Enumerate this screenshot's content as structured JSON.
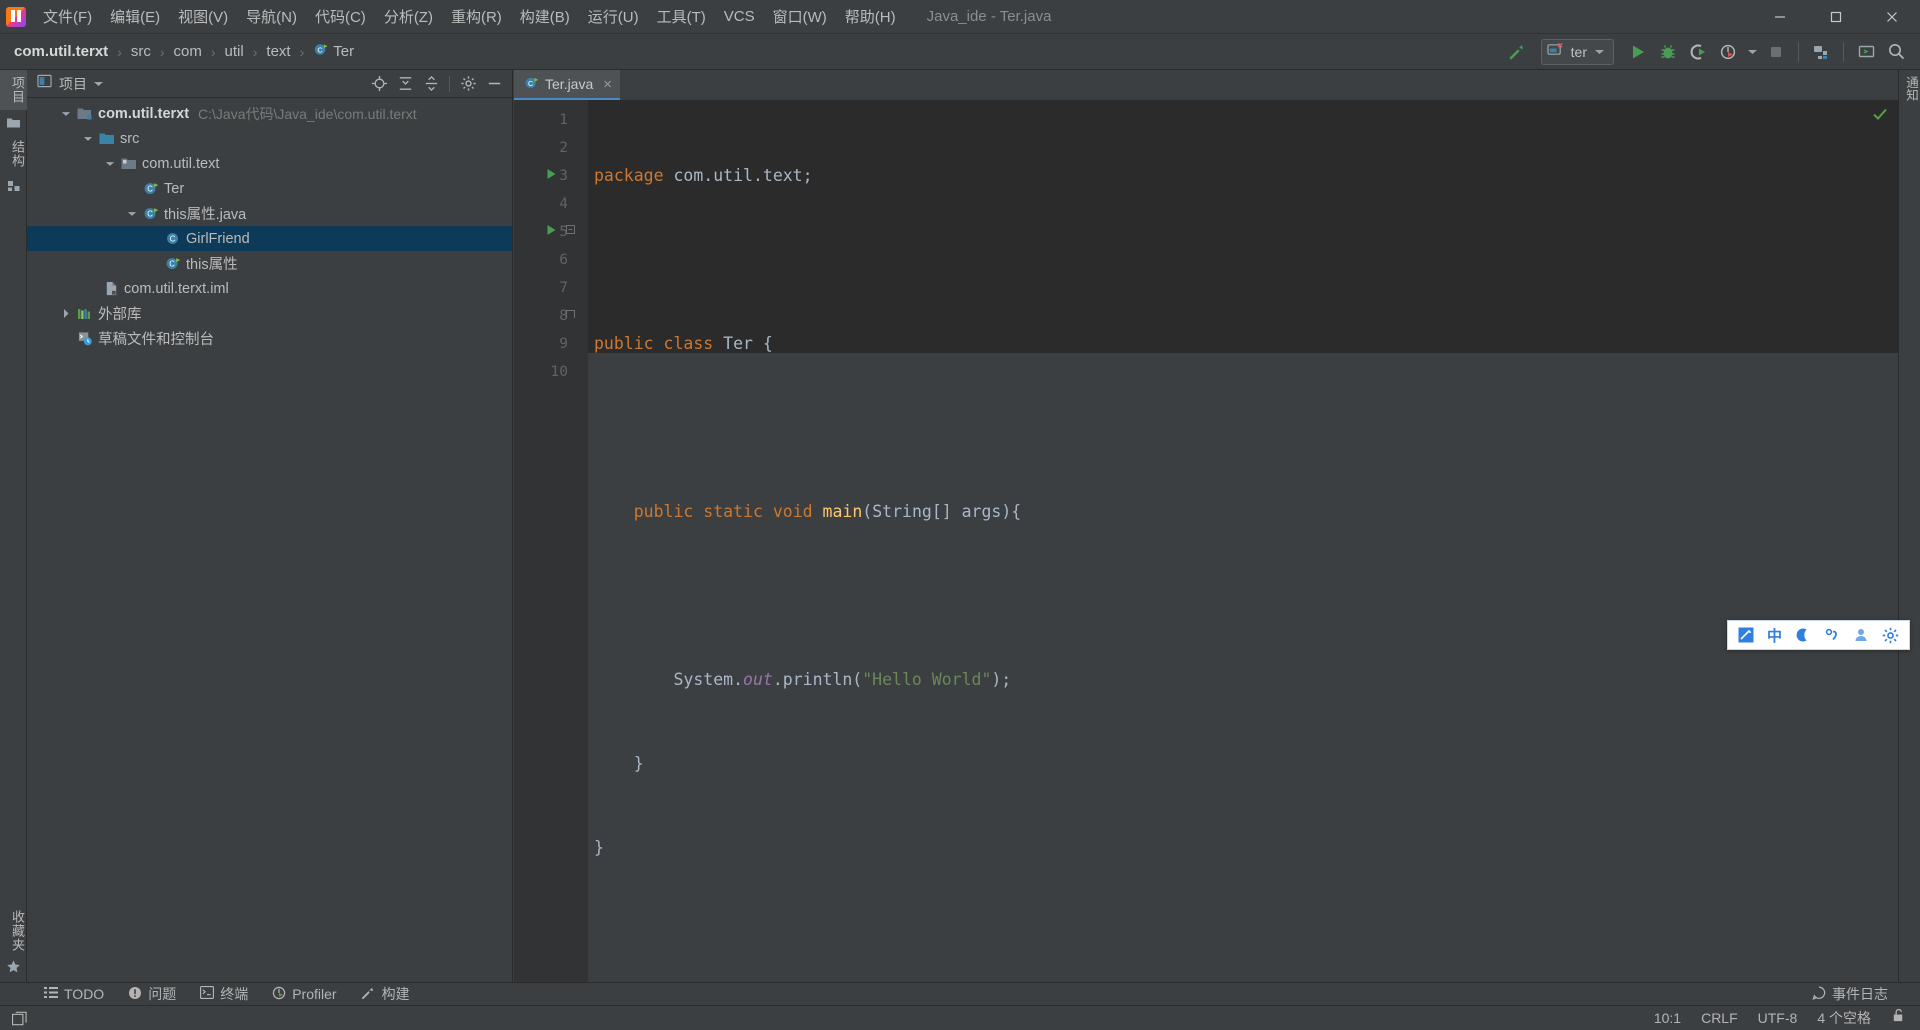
{
  "window": {
    "title": "Java_ide - Ter.java",
    "controls": {
      "minimize": "minimize-icon",
      "maximize": "maximize-icon",
      "close": "close-icon"
    }
  },
  "menubar": {
    "items": [
      {
        "label": "文件(F)"
      },
      {
        "label": "编辑(E)"
      },
      {
        "label": "视图(V)"
      },
      {
        "label": "导航(N)"
      },
      {
        "label": "代码(C)"
      },
      {
        "label": "分析(Z)"
      },
      {
        "label": "重构(R)"
      },
      {
        "label": "构建(B)"
      },
      {
        "label": "运行(U)"
      },
      {
        "label": "工具(T)"
      },
      {
        "label": "VCS"
      },
      {
        "label": "窗口(W)"
      },
      {
        "label": "帮助(H)"
      }
    ]
  },
  "navbar": {
    "breadcrumb": [
      {
        "label": "com.util.terxt",
        "bold": true
      },
      {
        "label": "src",
        "bold": false
      },
      {
        "label": "com",
        "bold": false
      },
      {
        "label": "util",
        "bold": false
      },
      {
        "label": "text",
        "bold": false
      },
      {
        "label": "Ter",
        "bold": false
      }
    ],
    "separator": "›",
    "toolbar": {
      "build_label": "build-hammer-icon",
      "run_config": "ter",
      "buttons": [
        "run-icon",
        "debug-icon",
        "run-with-coverage-icon",
        "profile-icon",
        "profile-dropdown-icon",
        "stop-icon",
        "project-structure-icon",
        "terminal-icon",
        "search-everywhere-icon"
      ]
    }
  },
  "left_strip": {
    "top_items": [
      {
        "label": "项目",
        "selected": true
      },
      {
        "label": "",
        "icon": "folder-icon",
        "selected": false
      },
      {
        "label": "结构",
        "selected": false
      },
      {
        "label": "",
        "icon": "bean-icon",
        "selected": false
      }
    ],
    "bottom_items": [
      {
        "label": "收藏夹",
        "icon": "star-icon"
      }
    ]
  },
  "right_strip": {
    "items": [
      {
        "label": "通知"
      }
    ]
  },
  "project_panel": {
    "title": "项目",
    "actions": [
      "locate-icon",
      "expand-all-icon",
      "collapse-all-icon",
      "settings-gear-icon",
      "hide-icon"
    ],
    "tree": [
      {
        "depth": 0,
        "arrow": "down",
        "icon": "module-icon",
        "label": "com.util.terxt",
        "bold": true,
        "path": "C:\\Java代码\\Java_ide\\com.util.terxt",
        "selected": false
      },
      {
        "depth": 1,
        "arrow": "down",
        "icon": "source-folder-icon",
        "label": "src",
        "bold": false,
        "path": "",
        "selected": false
      },
      {
        "depth": 2,
        "arrow": "down",
        "icon": "package-icon",
        "label": "com.util.text",
        "bold": false,
        "path": "",
        "selected": false
      },
      {
        "depth": 3,
        "arrow": "none",
        "icon": "java-class-runnable-icon",
        "label": "Ter",
        "bold": false,
        "path": "",
        "selected": false
      },
      {
        "depth": 3,
        "arrow": "down",
        "icon": "java-class-runnable-icon",
        "label": "this属性.java",
        "bold": false,
        "path": "",
        "selected": false
      },
      {
        "depth": 4,
        "arrow": "none",
        "icon": "java-class-icon",
        "label": "GirlFriend",
        "bold": false,
        "path": "",
        "selected": true
      },
      {
        "depth": 4,
        "arrow": "none",
        "icon": "java-class-runnable-icon",
        "label": "this属性",
        "bold": false,
        "path": "",
        "selected": false
      },
      {
        "depth": 1,
        "arrow": "none",
        "icon": "iml-file-icon",
        "label": "com.util.terxt.iml",
        "bold": false,
        "path": "",
        "selected": false
      },
      {
        "depth": 0,
        "arrow": "right",
        "icon": "libraries-icon",
        "label": "外部库",
        "bold": false,
        "path": "",
        "selected": false
      },
      {
        "depth": 0,
        "arrow": "none",
        "icon": "scratches-icon",
        "label": "草稿文件和控制台",
        "bold": false,
        "path": "",
        "selected": false
      }
    ]
  },
  "editor": {
    "tabs": [
      {
        "label": "Ter.java",
        "icon": "java-class-runnable-icon",
        "close": "×",
        "active": true
      }
    ],
    "lines": [
      {
        "no": "1",
        "run_marker": false,
        "fold": "",
        "tokens": [
          {
            "t": "kw",
            "v": "package"
          },
          {
            "t": "pln",
            "v": " com.util.text;"
          }
        ]
      },
      {
        "no": "2",
        "run_marker": false,
        "fold": "",
        "tokens": []
      },
      {
        "no": "3",
        "run_marker": true,
        "fold": "",
        "tokens": [
          {
            "t": "kw",
            "v": "public"
          },
          {
            "t": "pln",
            "v": " "
          },
          {
            "t": "kw",
            "v": "class"
          },
          {
            "t": "pln",
            "v": " Ter {"
          }
        ]
      },
      {
        "no": "4",
        "run_marker": false,
        "fold": "",
        "tokens": []
      },
      {
        "no": "5",
        "run_marker": true,
        "fold": "open",
        "tokens": [
          {
            "t": "pln",
            "v": "    "
          },
          {
            "t": "kw",
            "v": "public"
          },
          {
            "t": "pln",
            "v": " "
          },
          {
            "t": "kw",
            "v": "static"
          },
          {
            "t": "pln",
            "v": " "
          },
          {
            "t": "kw",
            "v": "void"
          },
          {
            "t": "pln",
            "v": " "
          },
          {
            "t": "fn",
            "v": "main"
          },
          {
            "t": "pln",
            "v": "(String[] args){"
          }
        ]
      },
      {
        "no": "6",
        "run_marker": false,
        "fold": "",
        "tokens": []
      },
      {
        "no": "7",
        "run_marker": false,
        "fold": "",
        "tokens": [
          {
            "t": "pln",
            "v": "        System."
          },
          {
            "t": "fld",
            "v": "out"
          },
          {
            "t": "pln",
            "v": ".println("
          },
          {
            "t": "str",
            "v": "\"Hello World\""
          },
          {
            "t": "pln",
            "v": ");"
          }
        ]
      },
      {
        "no": "8",
        "run_marker": false,
        "fold": "close",
        "tokens": [
          {
            "t": "pln",
            "v": "    }"
          }
        ]
      },
      {
        "no": "9",
        "run_marker": false,
        "fold": "",
        "tokens": [
          {
            "t": "pln",
            "v": "}"
          }
        ]
      },
      {
        "no": "10",
        "run_marker": false,
        "fold": "",
        "tokens": []
      }
    ],
    "inspection_status": "ok-check-icon"
  },
  "ime_bar": {
    "items": [
      {
        "name": "ime-mode-icon",
        "glyph": ""
      },
      {
        "name": "chinese-mode-icon",
        "glyph": "中"
      },
      {
        "name": "half-moon-icon",
        "glyph": ""
      },
      {
        "name": "punctuation-icon",
        "glyph": ""
      },
      {
        "name": "user-icon",
        "glyph": ""
      },
      {
        "name": "settings-gear-icon",
        "glyph": ""
      }
    ]
  },
  "toolwindow_bar": {
    "items": [
      {
        "label": "TODO",
        "icon": "todo-icon"
      },
      {
        "label": "问题",
        "icon": "problems-icon"
      },
      {
        "label": "终端",
        "icon": "terminal-icon"
      },
      {
        "label": "Profiler",
        "icon": "profiler-icon"
      },
      {
        "label": "构建",
        "icon": "build-hammer-icon"
      }
    ],
    "event_log": {
      "label": "事件日志",
      "icon": "event-log-icon"
    }
  },
  "statusbar": {
    "left_icon": "toggle-toolwindows-icon",
    "items": [
      {
        "label": "10:1",
        "name": "caret-position"
      },
      {
        "label": "CRLF",
        "name": "line-separator"
      },
      {
        "label": "UTF-8",
        "name": "file-encoding"
      },
      {
        "label": "4 个空格",
        "name": "indent-setting"
      }
    ],
    "lock_icon": "unlocked-icon"
  }
}
